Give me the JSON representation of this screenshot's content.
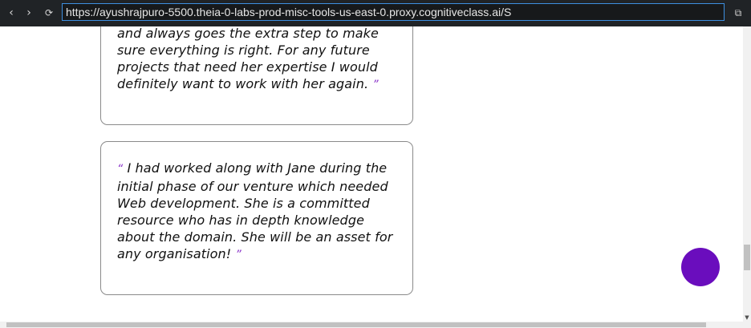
{
  "browser": {
    "back_icon": "‹",
    "forward_icon": "›",
    "reload_icon": "⟳",
    "url": "https://ayushrajpuro-5500.theia-0-labs-prod-misc-tools-us-east-0.proxy.cognitiveclass.ai/S",
    "open_external_icon": "⧉"
  },
  "testimonials": [
    {
      "open_quote": "",
      "text": "and always goes the extra step to make sure everything is right. For any future projects that need her expertise I would definitely want to work with her again.",
      "close_quote": "”"
    },
    {
      "open_quote": "“",
      "text": "I had worked along with Jane during the initial phase of our venture which needed Web development. She is a committed resource who has in depth knowledge about the domain. She will be an asset for any organisation!",
      "close_quote": "”"
    }
  ],
  "colors": {
    "quote_mark": "#8a33c9",
    "fab": "#6a0dbd",
    "url_border": "#3d8fe0"
  }
}
